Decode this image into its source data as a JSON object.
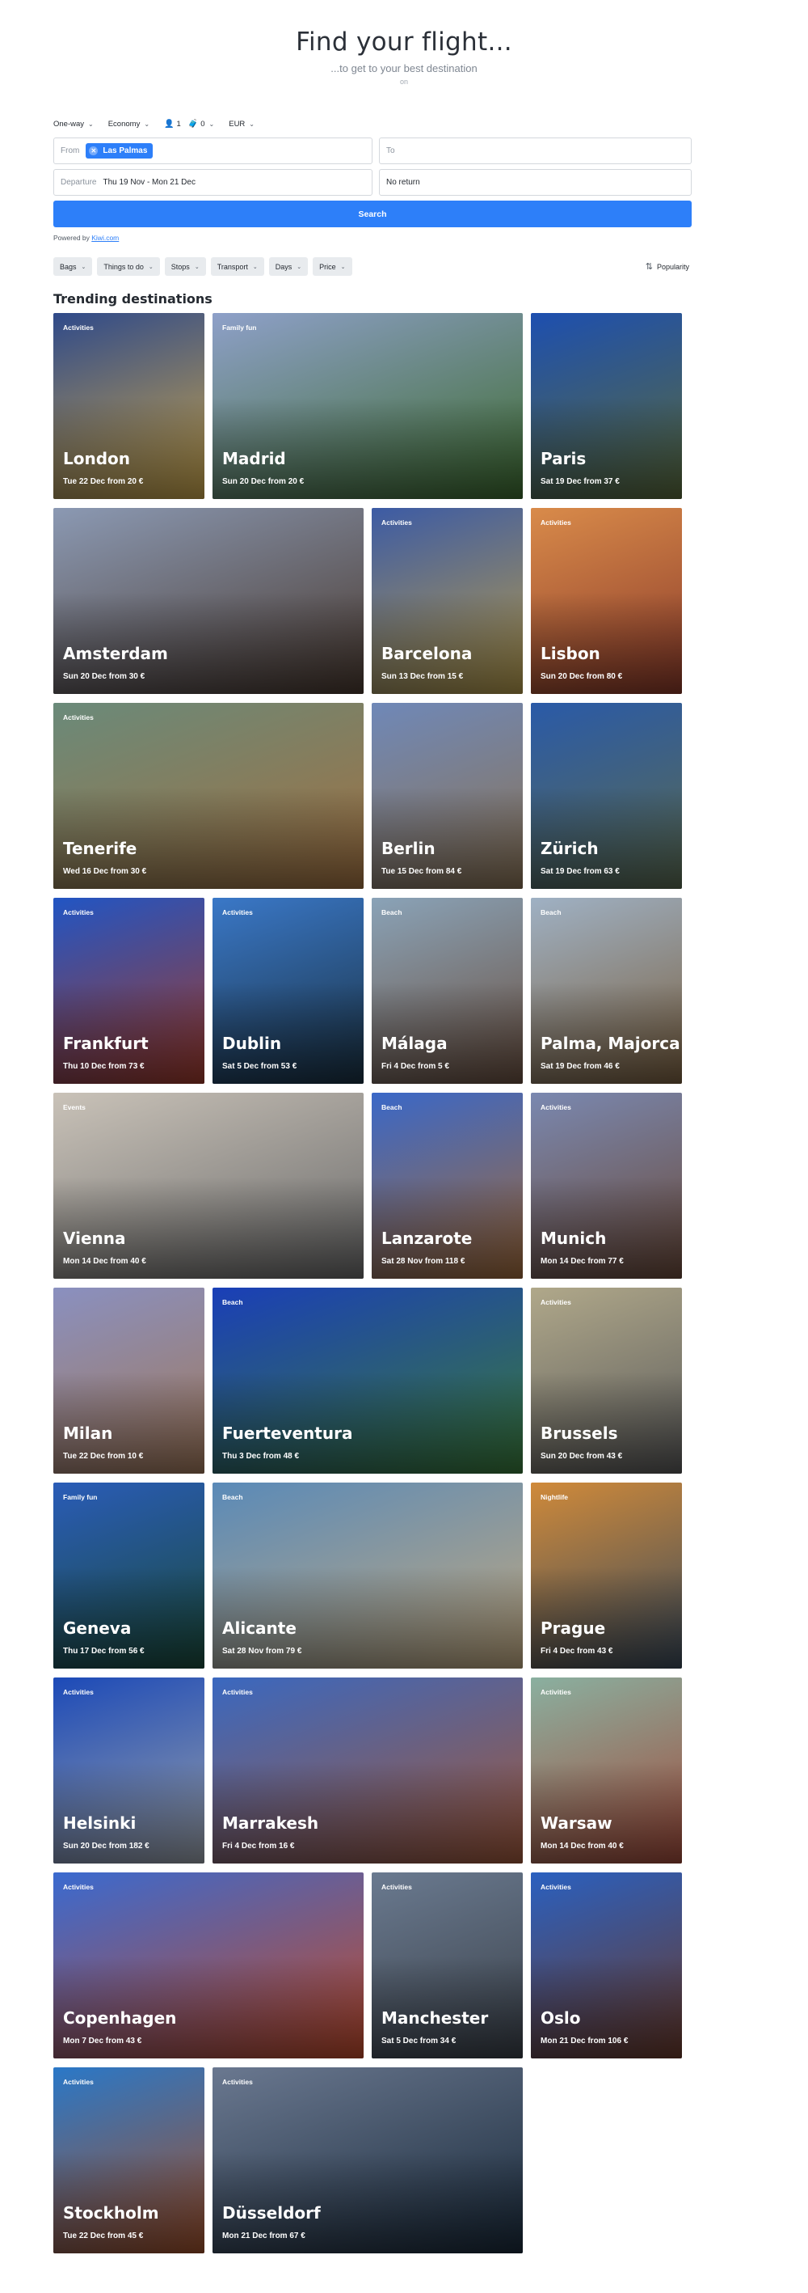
{
  "hero": {
    "title": "Find your flight...",
    "subtitle": "...to get to your best destination",
    "on": "on"
  },
  "options": {
    "trip_type": "One-way",
    "cabin": "Economy",
    "adults": "1",
    "bags": "0",
    "currency": "EUR"
  },
  "search": {
    "from_label": "From",
    "from_chip": "Las Palmas",
    "to_label": "To",
    "departure_label": "Departure",
    "departure_value": "Thu 19 Nov -  Mon 21 Dec",
    "return_value": "No return",
    "button": "Search"
  },
  "powered": {
    "prefix": "Powered by ",
    "link": "Kiwi.com"
  },
  "filters": [
    "Bags",
    "Things to do",
    "Stops",
    "Transport",
    "Days",
    "Price"
  ],
  "sort_label": "Popularity",
  "section_title": "Trending destinations",
  "destinations": [
    {
      "city": "London",
      "tag": "Activities",
      "deal": "Tue 22 Dec from 20 €",
      "colors": [
        "#2f4a8a",
        "#c9a44a"
      ]
    },
    {
      "city": "Madrid",
      "tag": "Family fun",
      "deal": "Sun 20 Dec from 20 €",
      "colors": [
        "#8ea0c9",
        "#3d6b2f"
      ]
    },
    {
      "city": "Paris",
      "tag": "",
      "deal": "Sat 19 Dec from 37 €",
      "colors": [
        "#1d4fb0",
        "#5a6a3a"
      ]
    },
    {
      "city": "Amsterdam",
      "tag": "",
      "deal": "Sun 20 Dec from 30 €",
      "colors": [
        "#8b99b3",
        "#4a3a30"
      ]
    },
    {
      "city": "Barcelona",
      "tag": "Activities",
      "deal": "Sun 13 Dec from 15 €",
      "colors": [
        "#3c5ba5",
        "#b59a4a"
      ]
    },
    {
      "city": "Lisbon",
      "tag": "Activities",
      "deal": "Sun 20 Dec from 80 €",
      "colors": [
        "#d98b4a",
        "#8a3a2a"
      ]
    },
    {
      "city": "Tenerife",
      "tag": "Activities",
      "deal": "Wed 16 Dec from 30 €",
      "colors": [
        "#6a8a7a",
        "#a07040"
      ]
    },
    {
      "city": "Berlin",
      "tag": "",
      "deal": "Tue 15 Dec from 84 €",
      "colors": [
        "#6f88b8",
        "#8a7355"
      ]
    },
    {
      "city": "Zürich",
      "tag": "",
      "deal": "Sat 19 Dec from 63 €",
      "colors": [
        "#2a5aa8",
        "#5a6a50"
      ]
    },
    {
      "city": "Frankfurt",
      "tag": "Activities",
      "deal": "Thu 10 Dec from 73 €",
      "colors": [
        "#2155c4",
        "#a03a2a"
      ]
    },
    {
      "city": "Dublin",
      "tag": "Activities",
      "deal": "Sat 5 Dec from 53 €",
      "colors": [
        "#3a78c8",
        "#1a3040"
      ]
    },
    {
      "city": "Málaga",
      "tag": "Beach",
      "deal": "Fri 4 Dec from 5 €",
      "colors": [
        "#8aa3b8",
        "#6a5040"
      ]
    },
    {
      "city": "Palma, Majorca",
      "tag": "Beach",
      "deal": "Sat 19 Dec from 46 €",
      "colors": [
        "#9fb1c4",
        "#7a6040"
      ]
    },
    {
      "city": "Vienna",
      "tag": "Events",
      "deal": "Mon 14 Dec from 40 €",
      "colors": [
        "#c9c2b8",
        "#6a6a6a"
      ]
    },
    {
      "city": "Lanzarote",
      "tag": "Beach",
      "deal": "Sat 28 Nov from 118 €",
      "colors": [
        "#3a68c8",
        "#a06a3a"
      ]
    },
    {
      "city": "Munich",
      "tag": "Activities",
      "deal": "Mon 14 Dec from 77 €",
      "colors": [
        "#7a88b0",
        "#6a4a3a"
      ]
    },
    {
      "city": "Milan",
      "tag": "",
      "deal": "Tue 22 Dec from 10 €",
      "colors": [
        "#8a90c0",
        "#a0785a"
      ]
    },
    {
      "city": "Fuerteventura",
      "tag": "Beach",
      "deal": "Thu 3 Dec from 48 €",
      "colors": [
        "#1a3fb8",
        "#3a7a3a"
      ]
    },
    {
      "city": "Brussels",
      "tag": "Activities",
      "deal": "Sun 20 Dec from 43 €",
      "colors": [
        "#b0a88a",
        "#5a5a5a"
      ]
    },
    {
      "city": "Geneva",
      "tag": "Family fun",
      "deal": "Thu 17 Dec from 56 €",
      "colors": [
        "#2a5cb8",
        "#1a4a3a"
      ]
    },
    {
      "city": "Alicante",
      "tag": "Beach",
      "deal": "Sat 28 Nov from 79 €",
      "colors": [
        "#5a8ab8",
        "#c0a880"
      ]
    },
    {
      "city": "Prague",
      "tag": "Nightlife",
      "deal": "Fri 4 Dec from 43 €",
      "colors": [
        "#d08a3a",
        "#3a4a5a"
      ]
    },
    {
      "city": "Helsinki",
      "tag": "Activities",
      "deal": "Sun 20 Dec from 182 €",
      "colors": [
        "#1c4ab8",
        "#9aa0a8"
      ]
    },
    {
      "city": "Marrakesh",
      "tag": "Activities",
      "deal": "Fri 4 Dec from 16 €",
      "colors": [
        "#3a68c0",
        "#a0583a"
      ]
    },
    {
      "city": "Warsaw",
      "tag": "Activities",
      "deal": "Mon 14 Dec from 40 €",
      "colors": [
        "#8ab0a0",
        "#a04a3a"
      ]
    },
    {
      "city": "Copenhagen",
      "tag": "Activities",
      "deal": "Mon 7 Dec from 43 €",
      "colors": [
        "#3a6ad0",
        "#c04a2a"
      ]
    },
    {
      "city": "Manchester",
      "tag": "Activities",
      "deal": "Sat 5 Dec from 34 €",
      "colors": [
        "#6a7a90",
        "#3a4048"
      ]
    },
    {
      "city": "Oslo",
      "tag": "Activities",
      "deal": "Mon 21 Dec from 106 €",
      "colors": [
        "#2a60c0",
        "#6a3a2a"
      ]
    },
    {
      "city": "Stockholm",
      "tag": "Activities",
      "deal": "Tue 22 Dec from 45 €",
      "colors": [
        "#2a78c8",
        "#a0502a"
      ]
    },
    {
      "city": "Düsseldorf",
      "tag": "Activities",
      "deal": "Mon 21 Dec from 67 €",
      "colors": [
        "#6a7890",
        "#1a2a3a"
      ]
    }
  ]
}
